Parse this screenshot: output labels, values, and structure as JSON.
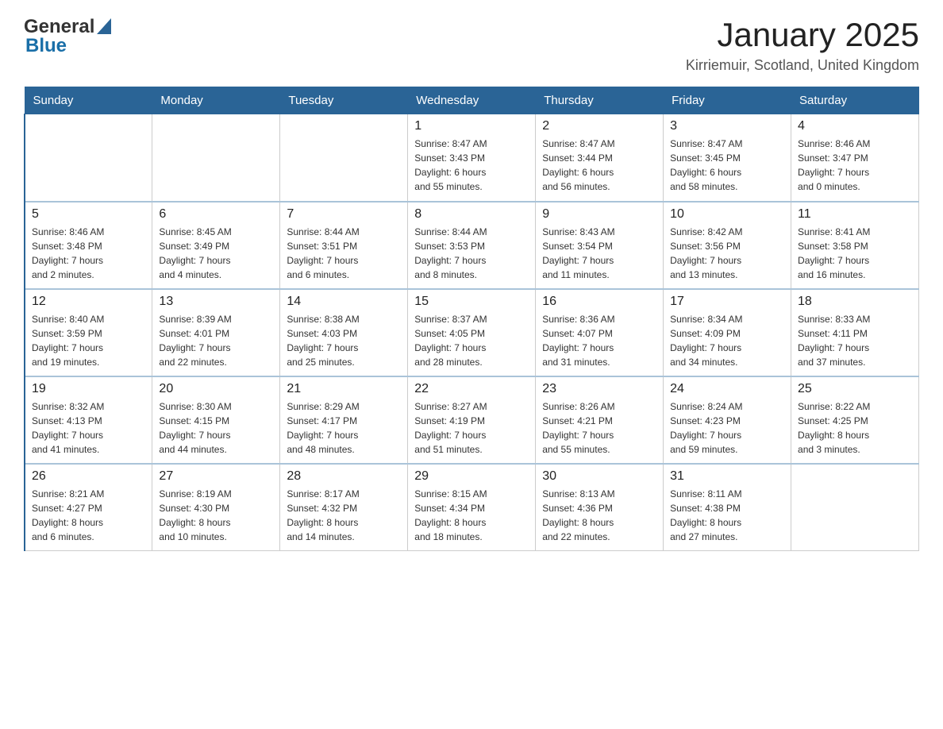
{
  "header": {
    "logo_general": "General",
    "logo_blue": "Blue",
    "title": "January 2025",
    "subtitle": "Kirriemuir, Scotland, United Kingdom"
  },
  "days_of_week": [
    "Sunday",
    "Monday",
    "Tuesday",
    "Wednesday",
    "Thursday",
    "Friday",
    "Saturday"
  ],
  "weeks": [
    [
      {
        "day": "",
        "info": ""
      },
      {
        "day": "",
        "info": ""
      },
      {
        "day": "",
        "info": ""
      },
      {
        "day": "1",
        "info": "Sunrise: 8:47 AM\nSunset: 3:43 PM\nDaylight: 6 hours\nand 55 minutes."
      },
      {
        "day": "2",
        "info": "Sunrise: 8:47 AM\nSunset: 3:44 PM\nDaylight: 6 hours\nand 56 minutes."
      },
      {
        "day": "3",
        "info": "Sunrise: 8:47 AM\nSunset: 3:45 PM\nDaylight: 6 hours\nand 58 minutes."
      },
      {
        "day": "4",
        "info": "Sunrise: 8:46 AM\nSunset: 3:47 PM\nDaylight: 7 hours\nand 0 minutes."
      }
    ],
    [
      {
        "day": "5",
        "info": "Sunrise: 8:46 AM\nSunset: 3:48 PM\nDaylight: 7 hours\nand 2 minutes."
      },
      {
        "day": "6",
        "info": "Sunrise: 8:45 AM\nSunset: 3:49 PM\nDaylight: 7 hours\nand 4 minutes."
      },
      {
        "day": "7",
        "info": "Sunrise: 8:44 AM\nSunset: 3:51 PM\nDaylight: 7 hours\nand 6 minutes."
      },
      {
        "day": "8",
        "info": "Sunrise: 8:44 AM\nSunset: 3:53 PM\nDaylight: 7 hours\nand 8 minutes."
      },
      {
        "day": "9",
        "info": "Sunrise: 8:43 AM\nSunset: 3:54 PM\nDaylight: 7 hours\nand 11 minutes."
      },
      {
        "day": "10",
        "info": "Sunrise: 8:42 AM\nSunset: 3:56 PM\nDaylight: 7 hours\nand 13 minutes."
      },
      {
        "day": "11",
        "info": "Sunrise: 8:41 AM\nSunset: 3:58 PM\nDaylight: 7 hours\nand 16 minutes."
      }
    ],
    [
      {
        "day": "12",
        "info": "Sunrise: 8:40 AM\nSunset: 3:59 PM\nDaylight: 7 hours\nand 19 minutes."
      },
      {
        "day": "13",
        "info": "Sunrise: 8:39 AM\nSunset: 4:01 PM\nDaylight: 7 hours\nand 22 minutes."
      },
      {
        "day": "14",
        "info": "Sunrise: 8:38 AM\nSunset: 4:03 PM\nDaylight: 7 hours\nand 25 minutes."
      },
      {
        "day": "15",
        "info": "Sunrise: 8:37 AM\nSunset: 4:05 PM\nDaylight: 7 hours\nand 28 minutes."
      },
      {
        "day": "16",
        "info": "Sunrise: 8:36 AM\nSunset: 4:07 PM\nDaylight: 7 hours\nand 31 minutes."
      },
      {
        "day": "17",
        "info": "Sunrise: 8:34 AM\nSunset: 4:09 PM\nDaylight: 7 hours\nand 34 minutes."
      },
      {
        "day": "18",
        "info": "Sunrise: 8:33 AM\nSunset: 4:11 PM\nDaylight: 7 hours\nand 37 minutes."
      }
    ],
    [
      {
        "day": "19",
        "info": "Sunrise: 8:32 AM\nSunset: 4:13 PM\nDaylight: 7 hours\nand 41 minutes."
      },
      {
        "day": "20",
        "info": "Sunrise: 8:30 AM\nSunset: 4:15 PM\nDaylight: 7 hours\nand 44 minutes."
      },
      {
        "day": "21",
        "info": "Sunrise: 8:29 AM\nSunset: 4:17 PM\nDaylight: 7 hours\nand 48 minutes."
      },
      {
        "day": "22",
        "info": "Sunrise: 8:27 AM\nSunset: 4:19 PM\nDaylight: 7 hours\nand 51 minutes."
      },
      {
        "day": "23",
        "info": "Sunrise: 8:26 AM\nSunset: 4:21 PM\nDaylight: 7 hours\nand 55 minutes."
      },
      {
        "day": "24",
        "info": "Sunrise: 8:24 AM\nSunset: 4:23 PM\nDaylight: 7 hours\nand 59 minutes."
      },
      {
        "day": "25",
        "info": "Sunrise: 8:22 AM\nSunset: 4:25 PM\nDaylight: 8 hours\nand 3 minutes."
      }
    ],
    [
      {
        "day": "26",
        "info": "Sunrise: 8:21 AM\nSunset: 4:27 PM\nDaylight: 8 hours\nand 6 minutes."
      },
      {
        "day": "27",
        "info": "Sunrise: 8:19 AM\nSunset: 4:30 PM\nDaylight: 8 hours\nand 10 minutes."
      },
      {
        "day": "28",
        "info": "Sunrise: 8:17 AM\nSunset: 4:32 PM\nDaylight: 8 hours\nand 14 minutes."
      },
      {
        "day": "29",
        "info": "Sunrise: 8:15 AM\nSunset: 4:34 PM\nDaylight: 8 hours\nand 18 minutes."
      },
      {
        "day": "30",
        "info": "Sunrise: 8:13 AM\nSunset: 4:36 PM\nDaylight: 8 hours\nand 22 minutes."
      },
      {
        "day": "31",
        "info": "Sunrise: 8:11 AM\nSunset: 4:38 PM\nDaylight: 8 hours\nand 27 minutes."
      },
      {
        "day": "",
        "info": ""
      }
    ]
  ]
}
